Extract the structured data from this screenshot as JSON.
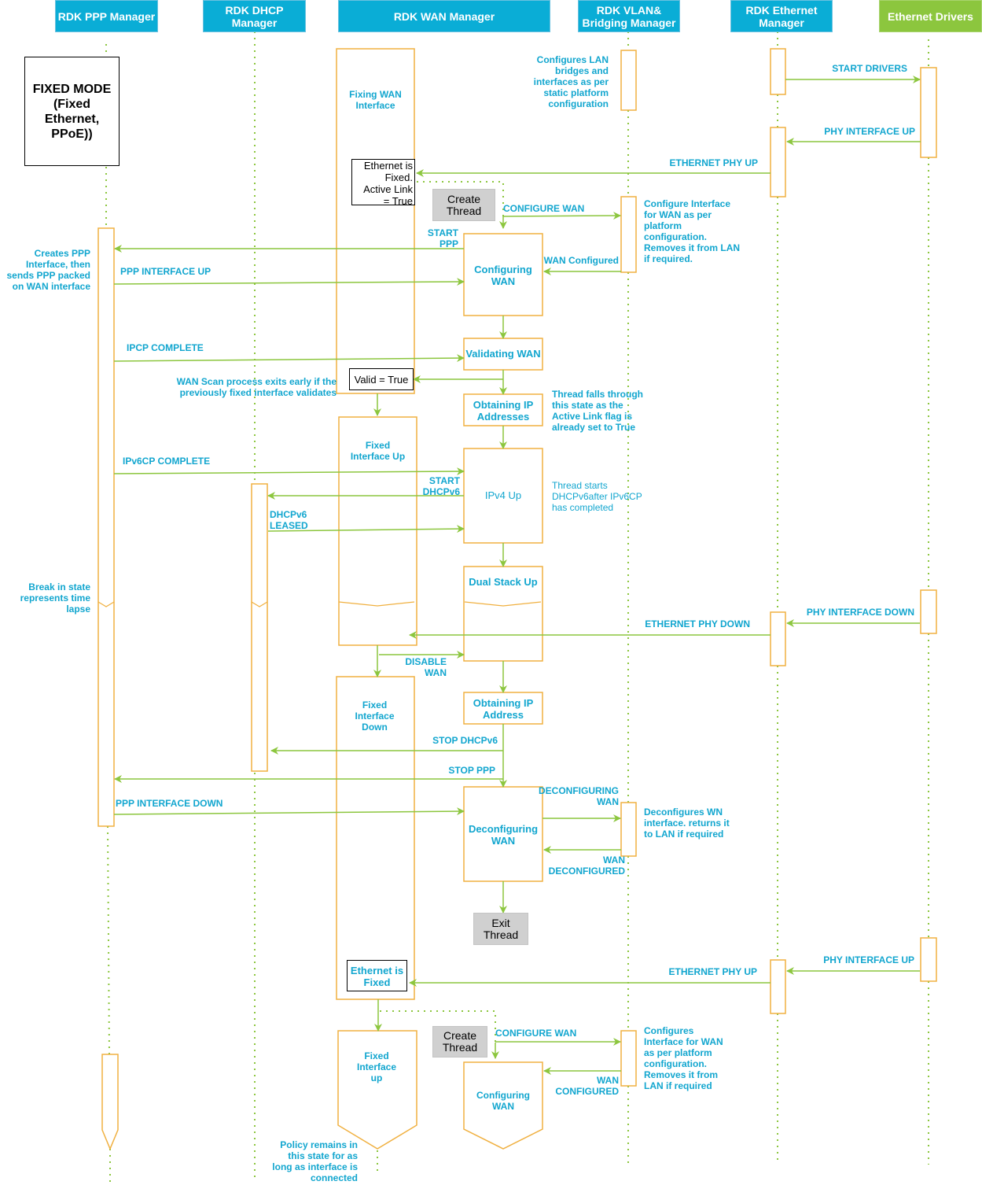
{
  "colors": {
    "header_blue": "#0aadd6",
    "header_green": "#8cc63e",
    "label_cyan": "#12a6cf",
    "activation_orange": "#f0b040",
    "arrow_green": "#8cc63e",
    "create_thread_gray": "#d0d0d0"
  },
  "lanes": [
    {
      "id": "ppp",
      "label": "RDK PPP Manager"
    },
    {
      "id": "dhcp",
      "label": "RDK DHCP\nManager"
    },
    {
      "id": "wan",
      "label": "RDK WAN Manager"
    },
    {
      "id": "vlan",
      "label": "RDK VLAN&\nBridging Manager"
    },
    {
      "id": "eth",
      "label": "RDK Ethernet\nManager"
    },
    {
      "id": "drv",
      "label": "Ethernet Drivers"
    }
  ],
  "mode_box": "FIXED MODE\n(Fixed\nEthernet,\nPPoE))",
  "policy_states": {
    "fixing_wan": "Fixing WAN\nInterface",
    "fixed_up": "Fixed\nInterface Up",
    "fixed_down": "Fixed\nInterface\nDown",
    "fixed_up_2": "Fixed\nInterface\nup"
  },
  "thread_states": {
    "configuring_wan": "Configuring\nWAN",
    "validating_wan": "Validating WAN",
    "obtaining_ip_addresses": "Obtaining IP\nAddresses",
    "ipv4_up": "IPv4 Up",
    "dual_stack_up": "Dual Stack Up",
    "obtaining_ip_address": "Obtaining IP\nAddress",
    "deconfiguring_wan": "Deconfiguring\nWAN",
    "configuring_wan_2": "Configuring\nWAN"
  },
  "boxes": {
    "ethernet_fixed_active": "Ethernet is\nFixed.\nActive Link\n= True",
    "valid_true": "Valid = True",
    "ethernet_fixed_2": "Ethernet is\nFixed",
    "create_thread_1": "Create\nThread",
    "exit_thread": "Exit\nThread",
    "create_thread_2": "Create\nThread"
  },
  "messages": {
    "start_drivers": "START DRIVERS",
    "phy_interface_up": "PHY INTERFACE UP",
    "ethernet_phy_up": "ETHERNET PHY UP",
    "configure_wan": "CONFIGURE WAN",
    "start_ppp": "START\nPPP",
    "wan_configured": "WAN Configured",
    "ppp_interface_up": "PPP INTERFACE UP",
    "ipcp_complete": "IPCP COMPLETE",
    "ipv6cp_complete": "IPv6CP COMPLETE",
    "start_dhcpv6": "START\nDHCPv6",
    "dhcpv6_leased": "DHCPv6\nLEASED",
    "phy_interface_down": "PHY INTERFACE DOWN",
    "ethernet_phy_down": "ETHERNET PHY DOWN",
    "disable_wan": "DISABLE\nWAN",
    "stop_dhcpv6": "STOP DHCPv6",
    "stop_ppp": "STOP PPP",
    "ppp_interface_down": "PPP INTERFACE DOWN",
    "deconfiguring_wan": "DECONFIGURING\nWAN",
    "wan_deconfigured": "WAN\nDECONFIGURED",
    "phy_interface_up_2": "PHY INTERFACE UP",
    "ethernet_phy_up_2": "ETHERNET PHY UP",
    "configure_wan_2": "CONFIGURE WAN",
    "wan_configured_2": "WAN\nCONFIGURED"
  },
  "notes": {
    "configures_lan": "Configures LAN\nbridges and\ninterfaces as  per\nstatic platform\nconfiguration",
    "configure_interface": "Configure Interface\nfor WAN as per\nplatform\nconfiguration.\nRemoves it from LAN\nif required.",
    "creates_ppp": "Creates PPP\nInterface, then\nsends PPP packed\non WAN interface",
    "wan_scan": "WAN Scan process exits early if the\npreviously fixed interface validates",
    "thread_falls": "Thread falls through\nthis state as the\nActive Link flag is\nalready set to True",
    "thread_starts": "Thread starts\nDHCPv6after IPv6CP\nhas completed",
    "break_in_state": "Break in state\nrepresents time\nlapse",
    "deconfigures": "Deconfigures WN\ninterface. returns it\nto LAN if required",
    "configures_interface_2": "Configures\nInterface for WAN\nas per platform\nconfiguration.\nRemoves it from\nLAN if required",
    "policy_remains": "Policy remains in\nthis state for as\nlong as interface is\nconnected"
  }
}
